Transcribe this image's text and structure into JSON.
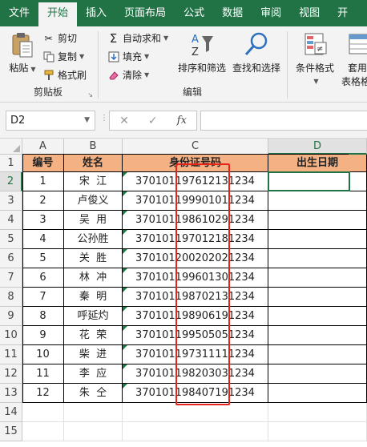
{
  "tabs": [
    "文件",
    "开始",
    "插入",
    "页面布局",
    "公式",
    "数据",
    "审阅",
    "视图",
    "开"
  ],
  "active_tab": 1,
  "clipboard": {
    "paste": "粘贴",
    "cut": "剪切",
    "copy": "复制",
    "format_painter": "格式刷",
    "group": "剪贴板"
  },
  "editing": {
    "autosum": "自动求和",
    "fill": "填充",
    "clear": "清除",
    "sort_filter": "排序和筛选",
    "find_select": "查找和选择",
    "group": "编辑"
  },
  "styles": {
    "cond_format": "条件格式",
    "table_format": "套用",
    "table_format2": "表格格"
  },
  "formula_bar": {
    "name_box": "D2",
    "cancel": "✕",
    "enter": "✓",
    "fx": "fx",
    "value": ""
  },
  "columns": [
    "A",
    "B",
    "C",
    "D"
  ],
  "rows": [
    "1",
    "2",
    "3",
    "4",
    "5",
    "6",
    "7",
    "8",
    "9",
    "10",
    "11",
    "12",
    "13",
    "14",
    "15"
  ],
  "table": {
    "headers": [
      "编号",
      "姓名",
      "身份证号码",
      "出生日期"
    ],
    "data": [
      [
        "1",
        "宋  江",
        "370101197612131234",
        ""
      ],
      [
        "2",
        "卢俊义",
        "370101199901011234",
        ""
      ],
      [
        "3",
        "吴  用",
        "370101198610291234",
        ""
      ],
      [
        "4",
        "公孙胜",
        "370101197012181234",
        ""
      ],
      [
        "5",
        "关  胜",
        "370101200202021234",
        ""
      ],
      [
        "6",
        "林  冲",
        "370101199601301234",
        ""
      ],
      [
        "7",
        "秦  明",
        "370101198702131234",
        ""
      ],
      [
        "8",
        "呼延灼",
        "370101198906191234",
        ""
      ],
      [
        "9",
        "花  荣",
        "370101199505051234",
        ""
      ],
      [
        "10",
        "柴  进",
        "370101197311111234",
        ""
      ],
      [
        "11",
        "李  应",
        "370101198203031234",
        ""
      ],
      [
        "12",
        "朱  仝",
        "370101198407191234",
        ""
      ]
    ]
  },
  "colors": {
    "excel_green": "#217346",
    "header_fill": "#f4b183",
    "highlight": "#e8231b"
  }
}
